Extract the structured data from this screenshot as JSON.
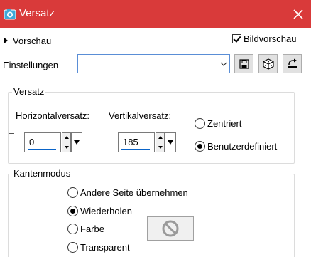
{
  "window": {
    "title": "Versatz"
  },
  "preview": {
    "label": "Vorschau",
    "bild_label": "Bildvorschau",
    "bild_checked": true
  },
  "settings": {
    "label": "Einstellungen",
    "value": ""
  },
  "offset_group": {
    "legend": "Versatz",
    "horizontal_label": "Horizontalversatz:",
    "horizontal_value": "0",
    "vertical_label": "Vertikalversatz:",
    "vertical_value": "185",
    "radio_centered": "Zentriert",
    "radio_custom": "Benutzerdefiniert",
    "selected": "custom"
  },
  "edge_group": {
    "legend": "Kantenmodus",
    "options": [
      "Andere Seite übernehmen",
      "Wiederholen",
      "Farbe",
      "Transparent"
    ],
    "selected_index": 1
  },
  "colors": {
    "titlebar": "#d93a3a",
    "accent": "#0a64c8"
  }
}
